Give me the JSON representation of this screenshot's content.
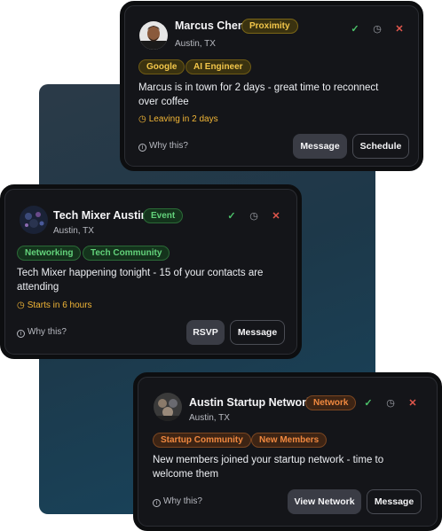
{
  "cards": [
    {
      "name": "Marcus Chen",
      "badge": "Proximity",
      "location": "Austin, TX",
      "tags": [
        "Google",
        "AI Engineer"
      ],
      "description": "Marcus is in town for 2 days - great time to reconnect over coffee",
      "time": "Leaving in 2 days",
      "why": "Why this?",
      "primary": "Message",
      "secondary": "Schedule"
    },
    {
      "name": "Tech Mixer Austin",
      "badge": "Event",
      "location": "Austin, TX",
      "tags": [
        "Networking",
        "Tech Community"
      ],
      "description": "Tech Mixer happening tonight - 15 of your contacts are attending",
      "time": "Starts in 6 hours",
      "why": "Why this?",
      "primary": "RSVP",
      "secondary": "Message"
    },
    {
      "name": "Austin Startup Network",
      "badge": "Network",
      "location": "Austin, TX",
      "tags": [
        "Startup Community",
        "New Members"
      ],
      "description": "New members joined your startup network - time to welcome them",
      "why": "Why this?",
      "primary": "View Network",
      "secondary": "Message"
    }
  ],
  "icons": {
    "accept": "check-icon",
    "snooze": "clock-icon",
    "dismiss": "close-icon",
    "info": "info-icon"
  }
}
